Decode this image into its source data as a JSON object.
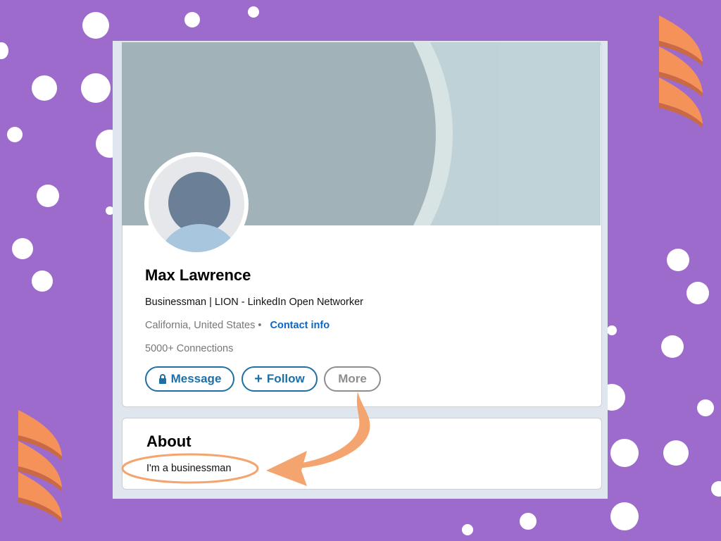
{
  "profile": {
    "name": "Max Lawrence",
    "headline": "Businessman | LION - LinkedIn Open Networker",
    "location": "California, United States",
    "location_sep": "•",
    "contact_label": "Contact info",
    "connections": "5000+ Connections"
  },
  "actions": {
    "message_label": "Message",
    "follow_label": "Follow",
    "follow_prefix": "+",
    "more_label": "More"
  },
  "about": {
    "title": "About",
    "text": "I'm a businessman"
  },
  "colors": {
    "background": "#9d6bcc",
    "accent_link": "#0a66c2",
    "button_blue": "#1d6fa5",
    "annotation_orange": "#f4a46e"
  }
}
